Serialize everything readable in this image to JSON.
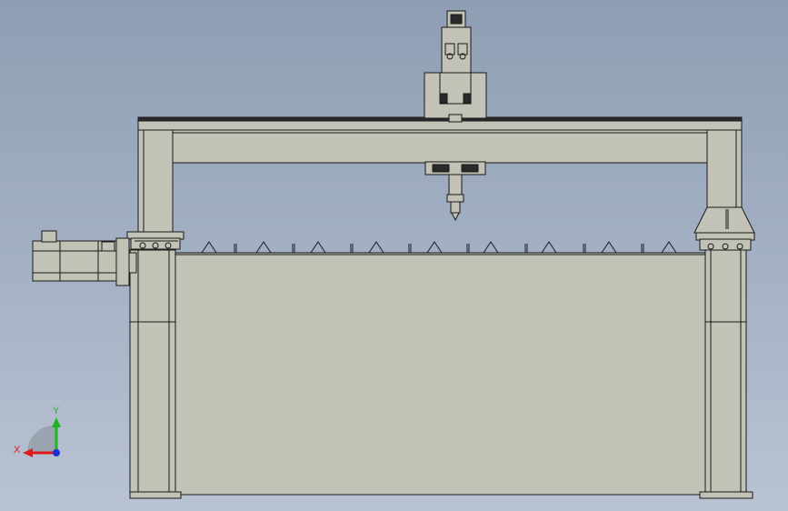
{
  "viewport": {
    "background_top": "#8f9eb4",
    "background_bottom": "#b9c3d2",
    "part_fill": "#c2c2b6",
    "edge_color": "#1a1a1a"
  },
  "triad": {
    "x_label": "X",
    "y_label": "Y",
    "x_color": "#e01b1b",
    "y_color": "#1fb41f",
    "z_color": "#1a2fd8"
  }
}
